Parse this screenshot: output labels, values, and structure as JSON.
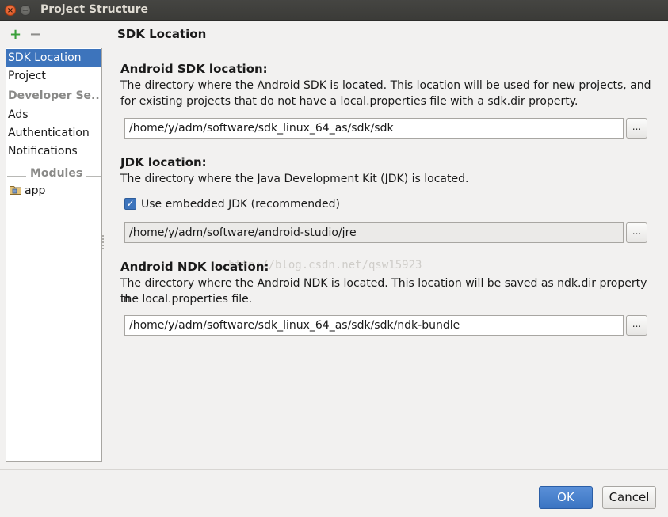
{
  "window": {
    "title": "Project Structure",
    "close_glyph": "×",
    "minimize_glyph": "−"
  },
  "toolbar": {
    "add_glyph": "+",
    "remove_glyph": "−"
  },
  "sidebar": {
    "items": [
      {
        "label": "SDK Location",
        "selected": true
      },
      {
        "label": "Project",
        "selected": false
      }
    ],
    "developer_section": "Developer Se...",
    "developer_items": [
      "Ads",
      "Authentication",
      "Notifications"
    ],
    "modules_header": "Modules",
    "modules": [
      "app"
    ]
  },
  "panel": {
    "title": "SDK Location",
    "android_sdk": {
      "label": "Android SDK location:",
      "description_line1": "The directory where the Android SDK is located. This location will be used for new projects, and",
      "description_line2": "for existing projects that do not have a local.properties file with a sdk.dir property.",
      "path": "/home/y/adm/software/sdk_linux_64_as/sdk/sdk",
      "browse_label": "..."
    },
    "jdk": {
      "label": "JDK location:",
      "description": "The directory where the Java Development Kit (JDK) is located.",
      "checkbox_label": "Use embedded JDK (recommended)",
      "checkbox_checked": true,
      "check_glyph": "✓",
      "path": "/home/y/adm/software/android-studio/jre",
      "browse_label": "..."
    },
    "android_ndk": {
      "label": "Android NDK location:",
      "description_line1": "The directory where the Android NDK is located. This location will be saved as ndk.dir property in",
      "description_line2": "the local.properties file.",
      "path": "/home/y/adm/software/sdk_linux_64_as/sdk/sdk/ndk-bundle",
      "browse_label": "..."
    },
    "watermark": "http://blog.csdn.net/qsw15923"
  },
  "footer": {
    "ok_label": "OK",
    "cancel_label": "Cancel"
  },
  "colors": {
    "accent": "#3d74bc",
    "add_icon": "#3aa03a",
    "titlebar": "#3c3b37"
  }
}
